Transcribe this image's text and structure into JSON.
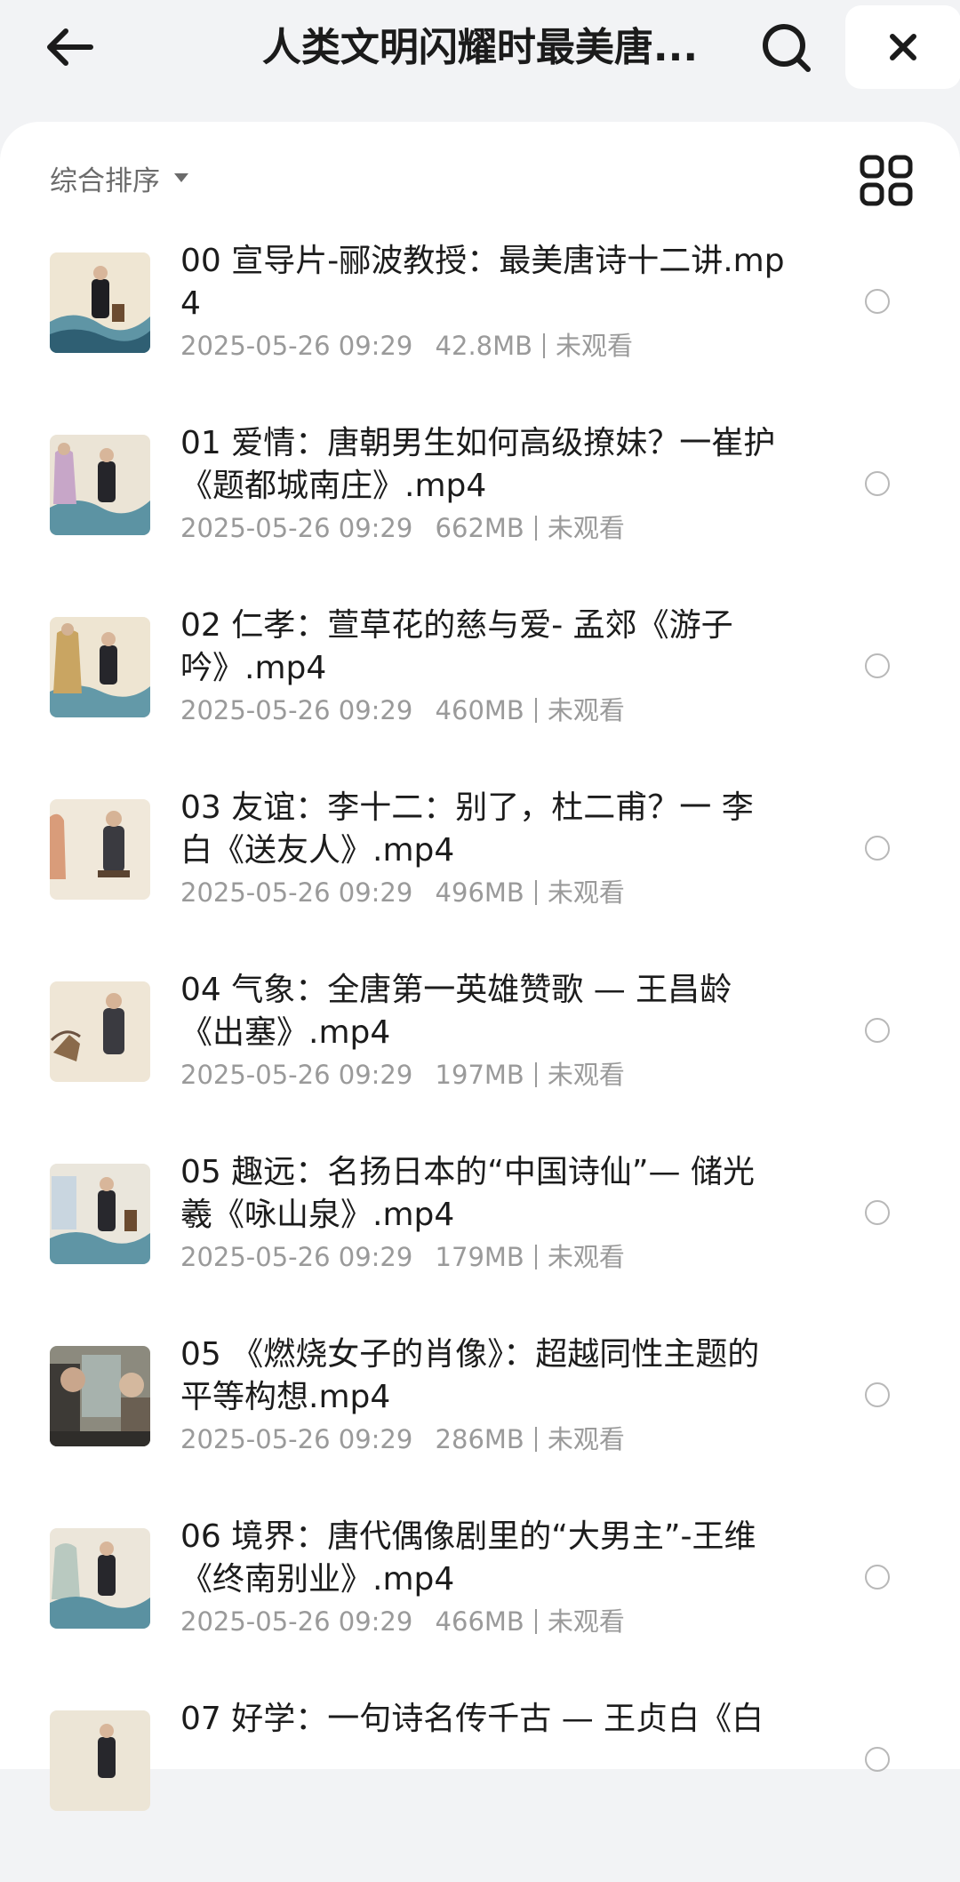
{
  "header": {
    "title": "人类文明闪耀时最美唐...",
    "icons": [
      "back-arrow-icon",
      "search-icon",
      "close-icon"
    ]
  },
  "toolbar": {
    "sort_label": "综合排序",
    "icons": [
      "caret-down-icon",
      "grid-view-icon"
    ]
  },
  "files": [
    {
      "name": "00 宣导片-郦波教授：最美唐诗十二讲.mp4",
      "date": "2025-05-26 09:29",
      "size": "42.8MB",
      "status": "未观看"
    },
    {
      "name": "01 爱情：唐朝男生如何高级撩妹？一崔护《题都城南庄》.mp4",
      "date": "2025-05-26 09:29",
      "size": "662MB",
      "status": "未观看"
    },
    {
      "name": "02 仁孝：萱草花的慈与爱- 孟郊《游子吟》.mp4",
      "date": "2025-05-26 09:29",
      "size": "460MB",
      "status": "未观看"
    },
    {
      "name": "03 友谊：李十二：别了，杜二甫？一 李白《送友人》.mp4",
      "date": "2025-05-26 09:29",
      "size": "496MB",
      "status": "未观看"
    },
    {
      "name": "04 气象：全唐第一英雄赞歌 — 王昌龄《出塞》.mp4",
      "date": "2025-05-26 09:29",
      "size": "197MB",
      "status": "未观看"
    },
    {
      "name": "05 趣远：名扬日本的“中国诗仙”— 储光羲《咏山泉》.mp4",
      "date": "2025-05-26 09:29",
      "size": "179MB",
      "status": "未观看"
    },
    {
      "name": "05 《燃烧女子的肖像》：超越同性主题的平等构想.mp4",
      "date": "2025-05-26 09:29",
      "size": "286MB",
      "status": "未观看"
    },
    {
      "name": "06 境界：唐代偶像剧里的“大男主”-王维《终南别业》.mp4",
      "date": "2025-05-26 09:29",
      "size": "466MB",
      "status": "未观看"
    },
    {
      "name": "07 好学：一句诗名传千古 — 王贞白《白",
      "date": "",
      "size": "",
      "status": ""
    }
  ]
}
